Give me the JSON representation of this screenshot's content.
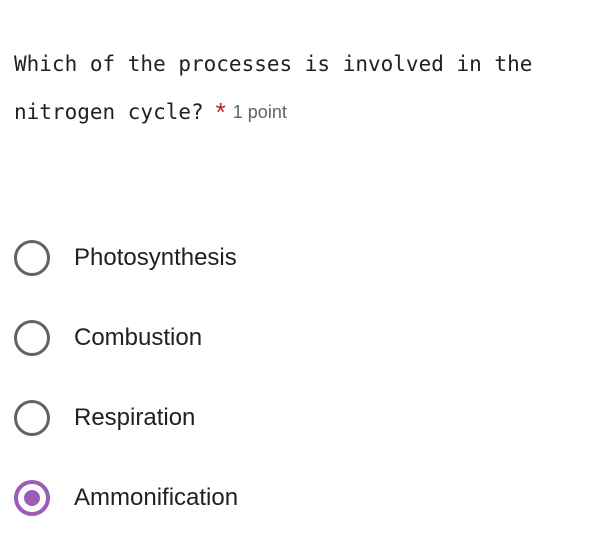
{
  "question": {
    "text": "Which of the processes is involved in the nitrogen cycle?",
    "required_marker": "*",
    "points_label": "1 point"
  },
  "options": [
    {
      "label": "Photosynthesis",
      "selected": false
    },
    {
      "label": "Combustion",
      "selected": false
    },
    {
      "label": "Respiration",
      "selected": false
    },
    {
      "label": "Ammonification",
      "selected": true
    }
  ],
  "colors": {
    "text": "#202124",
    "muted_text": "#5f6368",
    "required": "#b3261e",
    "accent": "#9a5cb4",
    "radio_border": "#5f6368",
    "background": "#ffffff"
  }
}
